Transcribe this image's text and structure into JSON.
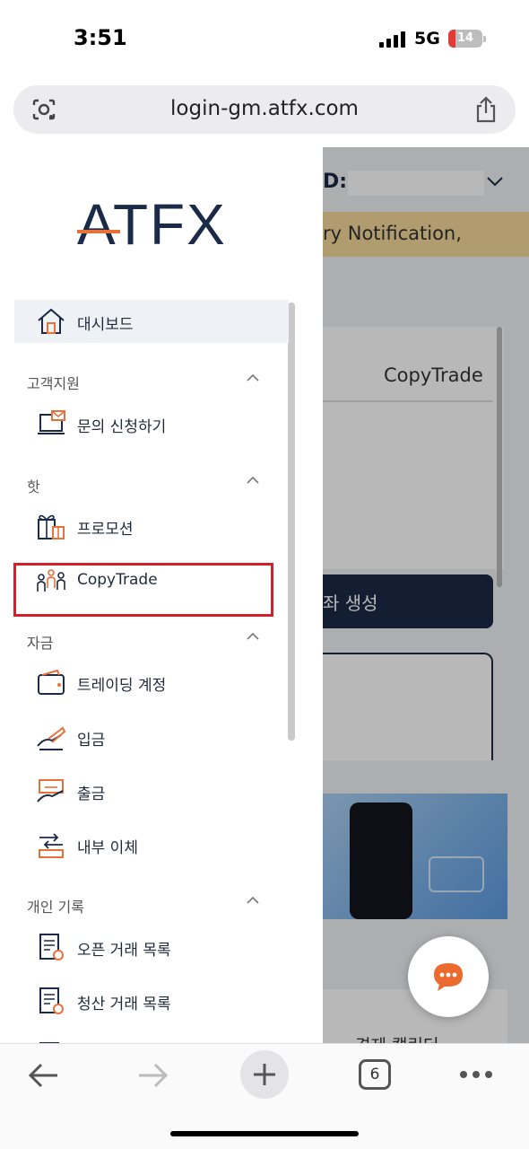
{
  "status_bar": {
    "time": "3:51",
    "network": "5G",
    "battery": "14"
  },
  "browser": {
    "url": "login-gm.atfx.com",
    "tab_count": "6"
  },
  "background_page": {
    "account_label": "D:",
    "notification_text": "ry Notification,",
    "tab_label": "CopyTrade",
    "button_text": "좌 생성",
    "bottom_text": "경제 캘린더"
  },
  "drawer": {
    "logo_text": "ATFX",
    "dashboard": "대시보드",
    "sections": [
      {
        "title": "고객지원",
        "items": [
          "문의 신청하기"
        ]
      },
      {
        "title": "핫",
        "items": [
          "프로모션",
          "CopyTrade"
        ]
      },
      {
        "title": "자금",
        "items": [
          "트레이딩 계정",
          "입금",
          "출금",
          "내부 이체"
        ]
      },
      {
        "title": "개인 기록",
        "items": [
          "오픈 거래 목록",
          "청산 거래 목록"
        ]
      }
    ]
  },
  "colors": {
    "brand_navy": "#1b2a47",
    "brand_orange": "#e8713a",
    "highlight_red": "#d2202a"
  }
}
